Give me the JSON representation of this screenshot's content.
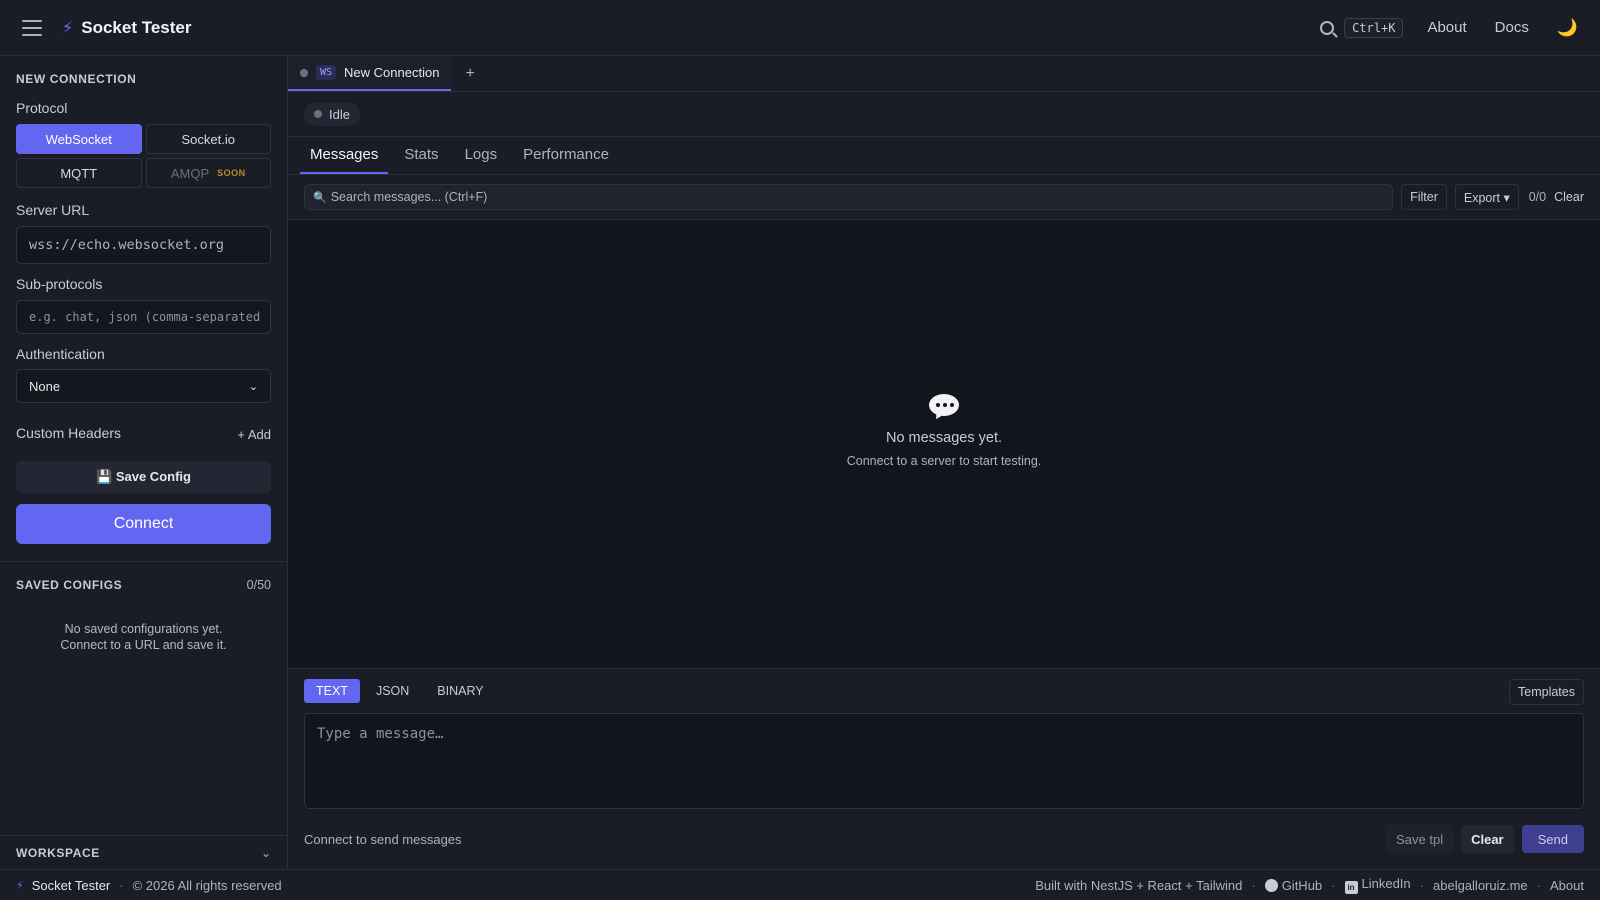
{
  "app": {
    "title": "Socket Tester",
    "brand_icon": "lightning-bolt-icon"
  },
  "header": {
    "search_shortcut": "Ctrl+K",
    "links": [
      "About",
      "Docs"
    ],
    "theme_icon": "moon-icon"
  },
  "sidebar": {
    "section_title": "NEW CONNECTION",
    "protocol_label": "Protocol",
    "protocols": {
      "websocket": "WebSocket",
      "socketio": "Socket.io",
      "mqtt": "MQTT",
      "amqp": "AMQP",
      "amqp_badge": "SOON"
    },
    "server_url_label": "Server URL",
    "server_url_value": "wss://echo.websocket.org",
    "subprotocols_label": "Sub-protocols",
    "subprotocols_placeholder": "e.g. chat, json (comma-separated",
    "auth_label": "Authentication",
    "auth_value": "None",
    "custom_headers_label": "Custom Headers",
    "add_label": "+ Add",
    "save_config_label": "💾 Save Config",
    "connect_label": "Connect",
    "saved_title": "SAVED CONFIGS",
    "saved_count": "0/50",
    "saved_empty_line1": "No saved configurations yet.",
    "saved_empty_line2": "Connect to a URL and save it.",
    "workspace_title": "WORKSPACE"
  },
  "main": {
    "tab": {
      "badge": "WS",
      "label": "New Connection",
      "add": "+"
    },
    "status": "Idle",
    "view_tabs": [
      "Messages",
      "Stats",
      "Logs",
      "Performance"
    ],
    "search_placeholder": "Search messages... (Ctrl+F)",
    "filter_label": "Filter",
    "export_label": "Export ▾",
    "count": "0/0",
    "clear_label": "Clear",
    "empty_title": "No messages yet.",
    "empty_sub": "Connect to a server to start testing.",
    "composer": {
      "formats": [
        "TEXT",
        "JSON",
        "BINARY"
      ],
      "templates_label": "Templates",
      "placeholder": "Type a message…",
      "hint": "Connect to send messages",
      "save_tpl_label": "Save tpl",
      "clear_label": "Clear",
      "send_label": "Send"
    }
  },
  "footer": {
    "brand": "Socket Tester",
    "copyright": "© 2026 All rights reserved",
    "built_with": "Built with NestJS + React + Tailwind",
    "github": "GitHub",
    "linkedin": "LinkedIn",
    "site": "abelgalloruiz.me",
    "about": "About"
  },
  "colors": {
    "accent": "#6366f1",
    "background": "#15171f",
    "panel": "#1a1d26"
  }
}
